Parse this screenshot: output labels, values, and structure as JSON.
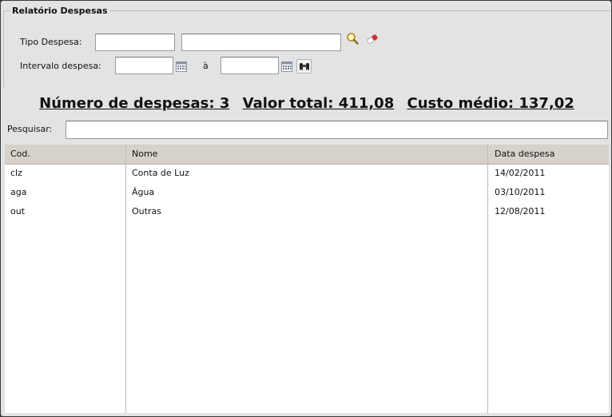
{
  "form": {
    "title": "Relatório Despesas",
    "tipo_label": "Tipo Despesa:",
    "intervalo_label": "Intervalo despesa:",
    "range_separator": "à",
    "tipo_code_value": "",
    "tipo_desc_value": "",
    "date_from_value": "",
    "date_to_value": ""
  },
  "summary": {
    "count_text": "Número de despesas: 3",
    "total_text": "Valor total: 411,08",
    "average_text": "Custo médio: 137,02"
  },
  "search": {
    "label": "Pesquisar:",
    "value": ""
  },
  "table": {
    "columns": [
      "Cod.",
      "Nome",
      "Data despesa"
    ],
    "rows": [
      [
        "clz",
        "Conta de Luz",
        "14/02/2011"
      ],
      [
        "aga",
        "Água",
        "03/10/2011"
      ],
      [
        "out",
        "Outras",
        "12/08/2011"
      ]
    ]
  },
  "icons": {
    "search": "search-icon",
    "clear": "eraser-icon",
    "calendar": "calendar-icon",
    "binoculars": "binoculars-icon"
  }
}
